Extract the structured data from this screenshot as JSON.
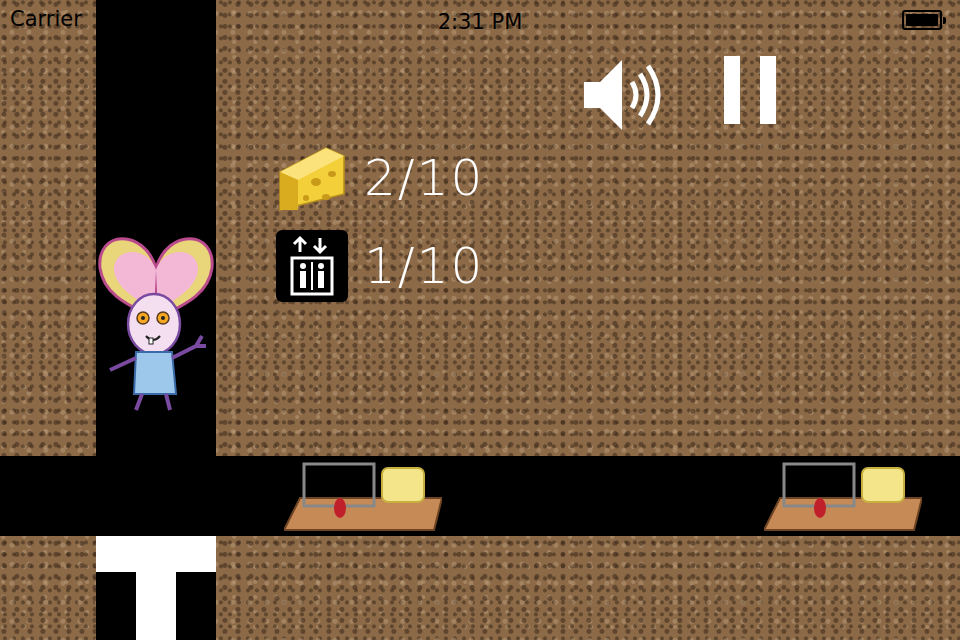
{
  "status_bar": {
    "carrier": "Carrier",
    "time": "2:31 PM",
    "battery_level": 1.0
  },
  "hud": {
    "cheese": "2/10",
    "elevators": "1/10"
  },
  "controls": {
    "sound_on": true,
    "paused": false
  }
}
